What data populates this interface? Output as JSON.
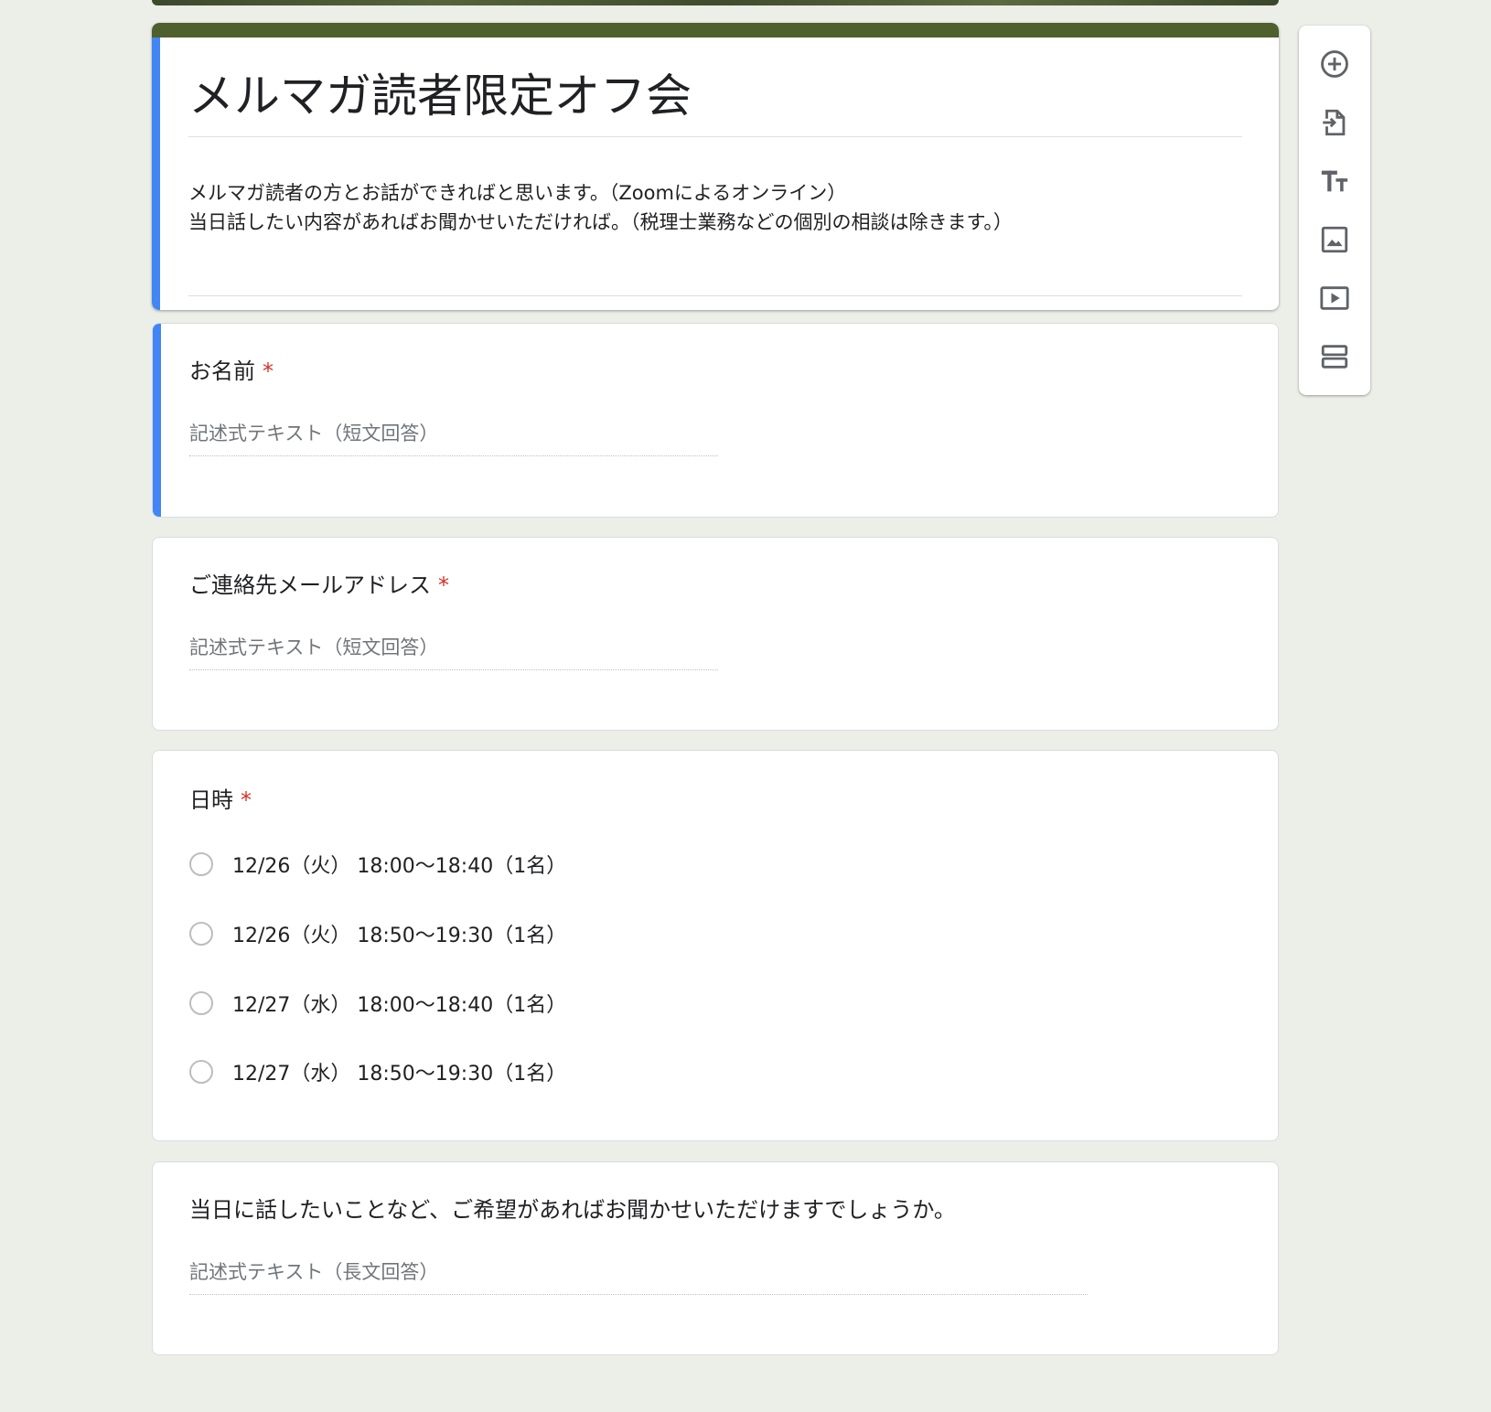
{
  "form": {
    "title": "メルマガ読者限定オフ会",
    "description_lines": [
      "メルマガ読者の方とお話ができればと思います。（Zoomによるオンライン）",
      "当日話したい内容があればお聞かせいただければ。（税理士業務などの個別の相談は除きます。）"
    ]
  },
  "questions": {
    "name": {
      "title": "お名前",
      "required_mark": "*",
      "placeholder": "記述式テキスト（短文回答）"
    },
    "email": {
      "title": "ご連絡先メールアドレス",
      "required_mark": "*",
      "placeholder": "記述式テキスト（短文回答）"
    },
    "datetime": {
      "title": "日時",
      "required_mark": "*",
      "options": [
        "12/26（火） 18:00〜18:40（1名）",
        "12/26（火） 18:50〜19:30（1名）",
        "12/27（水） 18:00〜18:40（1名）",
        "12/27（水） 18:50〜19:30（1名）"
      ]
    },
    "wishes": {
      "title": "当日に話したいことなど、ご希望があればお聞かせいただけますでしょうか。",
      "placeholder": "記述式テキスト（長文回答）"
    }
  },
  "toolbar": {
    "icons": [
      "add-question-icon",
      "import-questions-icon",
      "add-title-icon",
      "add-image-icon",
      "add-video-icon",
      "add-section-icon"
    ]
  },
  "colors": {
    "accent": "#4285f4",
    "theme": "#4f5f2d",
    "required": "#d93025",
    "background": "#eceee8"
  }
}
